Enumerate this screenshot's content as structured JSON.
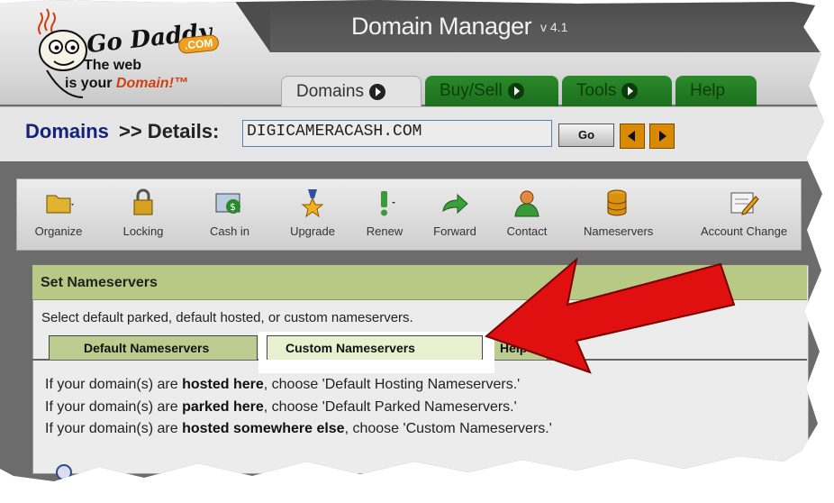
{
  "logo": {
    "brand": "Go Daddy",
    "dotcom": ".COM",
    "tagline_line1": "The web",
    "tagline_line2_prefix": "is your ",
    "tagline_line2_emphasis": "Domain!™"
  },
  "header": {
    "app_title": "Domain Manager",
    "version": "v 4.1"
  },
  "nav_tabs": [
    {
      "label": "Domains"
    },
    {
      "label": "Buy/Sell"
    },
    {
      "label": "Tools"
    },
    {
      "label": "Help"
    }
  ],
  "breadcrumb": {
    "domains": "Domains",
    "rest": ">> Details:"
  },
  "domain_input": {
    "value": "DIGICAMERACASH.COM"
  },
  "go_label": "Go",
  "toolbar": {
    "items": [
      {
        "label": "Organize",
        "icon": "folder-icon"
      },
      {
        "label": "Locking",
        "icon": "lock-icon"
      },
      {
        "label": "Cash in",
        "icon": "cash-in-icon"
      },
      {
        "label": "Upgrade",
        "icon": "medal-icon"
      },
      {
        "label": "Renew",
        "icon": "renew-icon"
      },
      {
        "label": "Forward",
        "icon": "forward-arrow-icon"
      },
      {
        "label": "Contact",
        "icon": "contact-person-icon"
      },
      {
        "label": "Nameservers",
        "icon": "database-icon"
      },
      {
        "label": "Account Change",
        "icon": "account-change-icon"
      }
    ]
  },
  "panel": {
    "title": "Set Nameservers",
    "description": "Select default parked, default hosted, or custom nameservers.",
    "tabs": [
      {
        "label": "Default Nameservers"
      },
      {
        "label": "Custom Nameservers"
      },
      {
        "label": "Help"
      }
    ],
    "lines": [
      {
        "pre": "If your domain(s) are ",
        "bold": "hosted here",
        "post": ", choose 'Default Hosting Nameservers.'"
      },
      {
        "pre": "If your domain(s) are ",
        "bold": "parked here",
        "post": ", choose 'Default Parked Nameservers.'"
      },
      {
        "pre": "If your domain(s) are ",
        "bold": "hosted somewhere else",
        "post": ", choose 'Custom Nameservers.'"
      }
    ]
  },
  "colors": {
    "accent_green": "#1f7a1f",
    "panel_header": "#b7c985",
    "breadcrumb_blue": "#13237a",
    "nav_arrow_orange": "#d98a00",
    "annotation_red": "#e01010"
  }
}
